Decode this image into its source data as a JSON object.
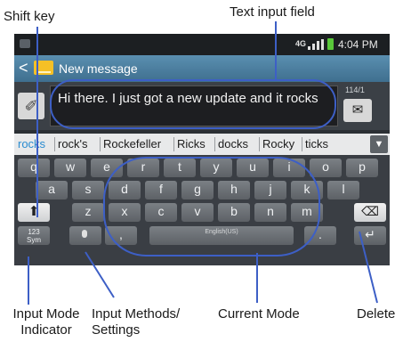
{
  "callouts": {
    "shift_key": "Shift key",
    "text_input_field": "Text input field",
    "input_mode_indicator": [
      "Input Mode",
      "Indicator"
    ],
    "input_methods_settings": [
      "Input Methods/",
      "Settings"
    ],
    "current_mode": "Current Mode",
    "delete": "Delete"
  },
  "status_bar": {
    "network": "4G",
    "time": "4:04 PM"
  },
  "title_bar": {
    "back": "<",
    "title": "New message"
  },
  "composer": {
    "attach_icon": "paperclip-icon",
    "message_text": "Hi there. I just got a new update and it rocks",
    "counter": "114/1",
    "send_icon": "send-message-icon"
  },
  "suggestions": {
    "items": [
      "rocks",
      "rock's",
      "Rockefeller",
      "Ricks",
      "docks",
      "Rocky",
      "ticks"
    ],
    "expand_icon": "chevron-down-icon"
  },
  "keyboard": {
    "row1": [
      "q",
      "w",
      "e",
      "r",
      "t",
      "y",
      "u",
      "i",
      "o",
      "p"
    ],
    "row2": [
      "a",
      "s",
      "d",
      "f",
      "g",
      "h",
      "j",
      "k",
      "l"
    ],
    "row3": [
      "z",
      "x",
      "c",
      "v",
      "b",
      "n",
      "m"
    ],
    "shift": "⬆",
    "delete": "⌫",
    "mode_key": [
      "123",
      "Sym"
    ],
    "comma": ",",
    "space_label": "English(US)",
    "period": ".",
    "enter": "↵"
  },
  "colors": {
    "annotation": "#3d5fc6",
    "titlebar": "#4c7fa0",
    "suggestion_active": "#2a8cd0"
  }
}
